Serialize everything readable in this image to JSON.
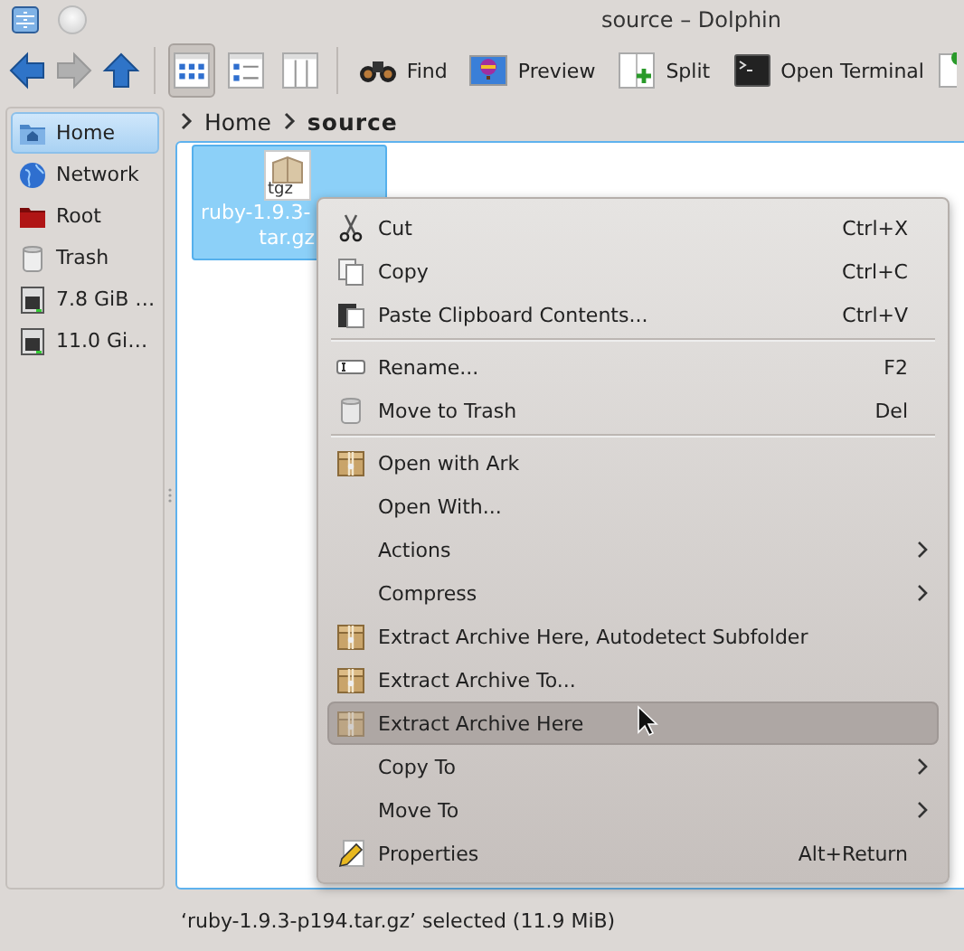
{
  "window": {
    "title": "source – Dolphin"
  },
  "toolbar": {
    "nav": [
      {
        "disabled": false
      },
      {
        "disabled": true
      },
      {
        "disabled": false
      }
    ],
    "views": [
      {
        "selected": true
      },
      {
        "selected": false
      },
      {
        "selected": false
      }
    ],
    "actions": [
      {
        "label": "Find"
      },
      {
        "label": "Preview"
      },
      {
        "label": "Split"
      },
      {
        "label": "Open Terminal"
      }
    ]
  },
  "places": [
    {
      "label": "Home",
      "selected": true
    },
    {
      "label": "Network",
      "selected": false
    },
    {
      "label": "Root",
      "selected": false
    },
    {
      "label": "Trash",
      "selected": false
    },
    {
      "label": "7.8 GiB …",
      "selected": false
    },
    {
      "label": "11.0 Gi…",
      "selected": false
    }
  ],
  "breadcrumb": [
    "Home",
    "source"
  ],
  "files": [
    {
      "badge": "tgz",
      "name_lines": [
        "ruby-1.9.3-",
        "tar.gz"
      ],
      "selected": true
    }
  ],
  "context_menu": [
    {
      "kind": "item",
      "label": "Cut",
      "shortcut": "Ctrl+X",
      "submenu": false,
      "selected": false
    },
    {
      "kind": "item",
      "label": "Copy",
      "shortcut": "Ctrl+C",
      "submenu": false,
      "selected": false
    },
    {
      "kind": "item",
      "label": "Paste Clipboard Contents...",
      "shortcut": "Ctrl+V",
      "submenu": false,
      "selected": false
    },
    {
      "kind": "separator"
    },
    {
      "kind": "item",
      "label": "Rename...",
      "shortcut": "F2",
      "submenu": false,
      "selected": false
    },
    {
      "kind": "item",
      "label": "Move to Trash",
      "shortcut": "Del",
      "submenu": false,
      "selected": false
    },
    {
      "kind": "separator"
    },
    {
      "kind": "item",
      "label": "Open with Ark",
      "submenu": false,
      "selected": false
    },
    {
      "kind": "item",
      "label": "Open With...",
      "submenu": false,
      "selected": false
    },
    {
      "kind": "item",
      "label": "Actions",
      "submenu": true,
      "selected": false
    },
    {
      "kind": "item",
      "label": "Compress",
      "submenu": true,
      "selected": false
    },
    {
      "kind": "item",
      "label": "Extract Archive Here, Autodetect Subfolder",
      "submenu": false,
      "selected": false
    },
    {
      "kind": "item",
      "label": "Extract Archive To...",
      "submenu": false,
      "selected": false
    },
    {
      "kind": "item",
      "label": "Extract Archive Here",
      "submenu": false,
      "selected": true
    },
    {
      "kind": "item",
      "label": "Copy To",
      "submenu": true,
      "selected": false
    },
    {
      "kind": "item",
      "label": "Move To",
      "submenu": true,
      "selected": false
    },
    {
      "kind": "item",
      "label": "Properties",
      "shortcut": "Alt+Return",
      "submenu": false,
      "selected": false
    }
  ],
  "status_bar": {
    "text": "‘ruby-1.9.3-p194.tar.gz’ selected (11.9 MiB)"
  }
}
